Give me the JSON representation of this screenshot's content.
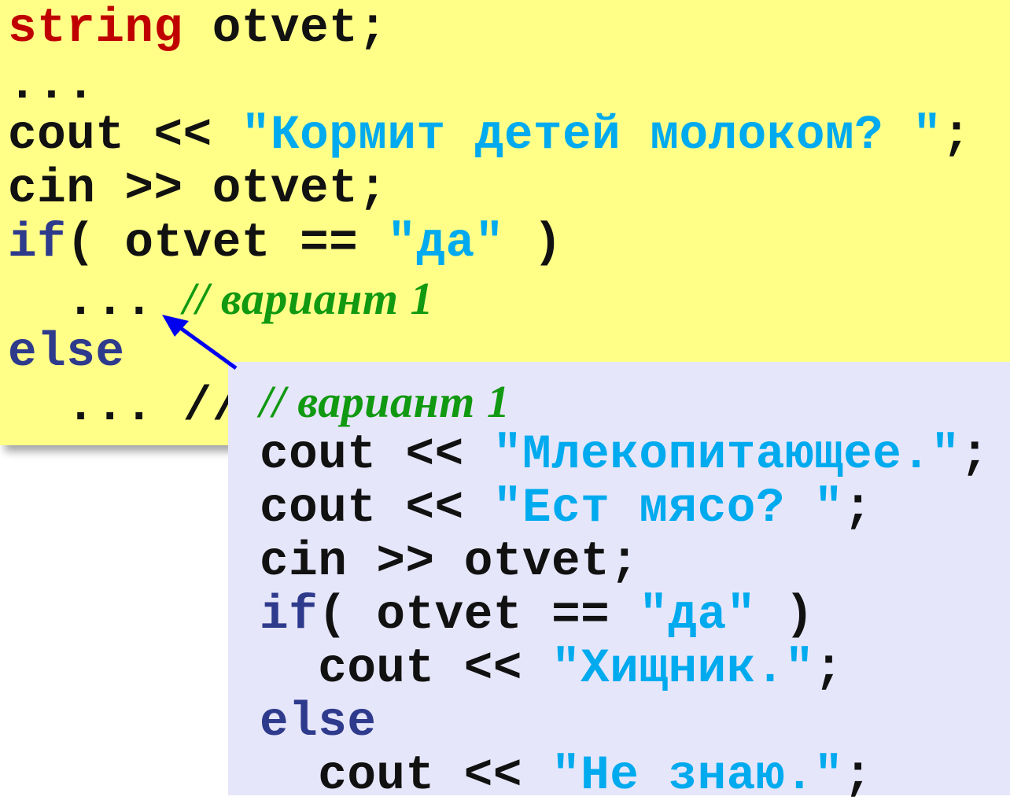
{
  "main_code": {
    "line1": {
      "type": "string",
      "rest": " otvet;"
    },
    "line2": {
      "text": "..."
    },
    "line3": {
      "code": "cout << ",
      "str": "\"Кормит детей молоком? \"",
      "end": ";"
    },
    "line4": {
      "text": "cin >> otvet;"
    },
    "line5": {
      "kw": "if",
      "code": "( otvet == ",
      "str": "\"да\"",
      "end": " )"
    },
    "line6": {
      "code": "  ... ",
      "comment": "// вариант 1"
    },
    "line7": {
      "kw": "else"
    },
    "line8": {
      "code": "  ... //"
    }
  },
  "popup_code": {
    "line1": {
      "comment": "// вариант 1"
    },
    "line2": {
      "code": "cout << ",
      "str": "\"Млекопитающее.\"",
      "end": ";"
    },
    "line3": {
      "code": "cout << ",
      "str": "\"Ест мясо? \"",
      "end": ";"
    },
    "line4": {
      "text": "cin >> otvet;"
    },
    "line5": {
      "kw": "if",
      "code": "( otvet == ",
      "str": "\"да\"",
      "end": " )"
    },
    "line6": {
      "code": "  cout << ",
      "str": "\"Хищник.\"",
      "end": ";"
    },
    "line7": {
      "kw": "else"
    },
    "line8": {
      "code": "  cout << ",
      "str": "\"Не знаю.\"",
      "end": ";"
    }
  },
  "colors": {
    "main_background": "#ffff88",
    "popup_background": "#e6e6fa",
    "type_keyword": "#c00000",
    "keyword": "#2e3a8c",
    "string": "#00aaee",
    "comment": "#119911",
    "arrow": "#0000ee"
  }
}
